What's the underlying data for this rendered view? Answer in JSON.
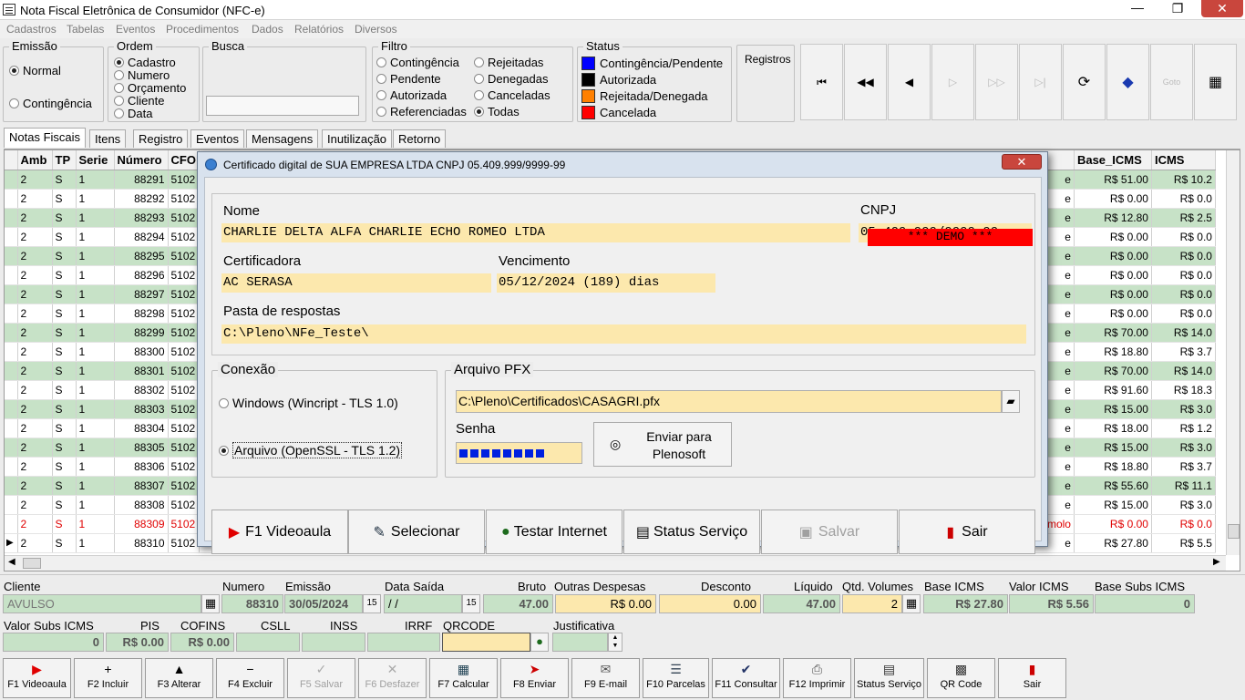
{
  "window": {
    "title": "Nota Fiscal Eletrônica de Consumidor (NFC-e)",
    "minimize": "—",
    "maximize": "❐",
    "close": "✕"
  },
  "menu": [
    "Cadastros",
    "Tabelas",
    "Eventos",
    "Procedimentos",
    "Dados",
    "Relatórios",
    "Diversos"
  ],
  "emissao": {
    "label": "Emissão",
    "options": [
      "Normal",
      "Contingência"
    ]
  },
  "ordem": {
    "label": "Ordem",
    "options": [
      "Cadastro",
      "Numero",
      "Orçamento",
      "Cliente",
      "Data"
    ]
  },
  "busca": {
    "label": "Busca",
    "value": ""
  },
  "filtro": {
    "label": "Filtro",
    "col1": [
      "Contingência",
      "Pendente",
      "Autorizada",
      "Referenciadas"
    ],
    "col2": [
      "Rejeitadas",
      "Denegadas",
      "Canceladas",
      "Todas"
    ]
  },
  "status": {
    "label": "Status",
    "items": [
      {
        "label": "Contingência/Pendente",
        "color": "#0000ff"
      },
      {
        "label": "Autorizada",
        "color": "#000000"
      },
      {
        "label": "Rejeitada/Denegada",
        "color": "#ff8000"
      },
      {
        "label": "Cancelada",
        "color": "#ff0000"
      }
    ]
  },
  "registros": {
    "label": "Registros"
  },
  "nav": {
    "first": "⏮",
    "prev_page": "◀◀",
    "prev": "◀",
    "next": "▷",
    "next_page": "▷▷",
    "last": "▷|",
    "refresh": "⟳",
    "tag": "◆",
    "goto": "Goto",
    "calc": "▦"
  },
  "tabs": [
    "Notas Fiscais",
    "Itens",
    "Registro",
    "Eventos",
    "Mensagens",
    "Inutilização",
    "Retorno"
  ],
  "grid": {
    "columns": [
      "Amb",
      "TP",
      "Serie",
      "Número",
      "CFO"
    ],
    "right_columns": [
      "Base_ICMS",
      "ICMS"
    ],
    "rows": [
      {
        "amb": "2",
        "tp": "S",
        "serie": "1",
        "numero": "88291",
        "cfo": "5102",
        "status": "e",
        "base": "R$ 51.00",
        "icms": "R$ 10.2",
        "style": "green"
      },
      {
        "amb": "2",
        "tp": "S",
        "serie": "1",
        "numero": "88292",
        "cfo": "5102",
        "status": "e",
        "base": "R$ 0.00",
        "icms": "R$ 0.0",
        "style": ""
      },
      {
        "amb": "2",
        "tp": "S",
        "serie": "1",
        "numero": "88293",
        "cfo": "5102",
        "status": "e",
        "base": "R$ 12.80",
        "icms": "R$ 2.5",
        "style": "green"
      },
      {
        "amb": "2",
        "tp": "S",
        "serie": "1",
        "numero": "88294",
        "cfo": "5102",
        "status": "e",
        "base": "R$ 0.00",
        "icms": "R$ 0.0",
        "style": ""
      },
      {
        "amb": "2",
        "tp": "S",
        "serie": "1",
        "numero": "88295",
        "cfo": "5102",
        "status": "e",
        "base": "R$ 0.00",
        "icms": "R$ 0.0",
        "style": "green"
      },
      {
        "amb": "2",
        "tp": "S",
        "serie": "1",
        "numero": "88296",
        "cfo": "5102",
        "status": "e",
        "base": "R$ 0.00",
        "icms": "R$ 0.0",
        "style": ""
      },
      {
        "amb": "2",
        "tp": "S",
        "serie": "1",
        "numero": "88297",
        "cfo": "5102",
        "status": "e",
        "base": "R$ 0.00",
        "icms": "R$ 0.0",
        "style": "green"
      },
      {
        "amb": "2",
        "tp": "S",
        "serie": "1",
        "numero": "88298",
        "cfo": "5102",
        "status": "e",
        "base": "R$ 0.00",
        "icms": "R$ 0.0",
        "style": ""
      },
      {
        "amb": "2",
        "tp": "S",
        "serie": "1",
        "numero": "88299",
        "cfo": "5102",
        "status": "e",
        "base": "R$ 70.00",
        "icms": "R$ 14.0",
        "style": "green"
      },
      {
        "amb": "2",
        "tp": "S",
        "serie": "1",
        "numero": "88300",
        "cfo": "5102",
        "status": "e",
        "base": "R$ 18.80",
        "icms": "R$ 3.7",
        "style": ""
      },
      {
        "amb": "2",
        "tp": "S",
        "serie": "1",
        "numero": "88301",
        "cfo": "5102",
        "status": "e",
        "base": "R$ 70.00",
        "icms": "R$ 14.0",
        "style": "green"
      },
      {
        "amb": "2",
        "tp": "S",
        "serie": "1",
        "numero": "88302",
        "cfo": "5102",
        "status": "e",
        "base": "R$ 91.60",
        "icms": "R$ 18.3",
        "style": ""
      },
      {
        "amb": "2",
        "tp": "S",
        "serie": "1",
        "numero": "88303",
        "cfo": "5102",
        "status": "e",
        "base": "R$ 15.00",
        "icms": "R$ 3.0",
        "style": "green"
      },
      {
        "amb": "2",
        "tp": "S",
        "serie": "1",
        "numero": "88304",
        "cfo": "5102",
        "status": "e",
        "base": "R$ 18.00",
        "icms": "R$ 1.2",
        "style": ""
      },
      {
        "amb": "2",
        "tp": "S",
        "serie": "1",
        "numero": "88305",
        "cfo": "5102",
        "status": "e",
        "base": "R$ 15.00",
        "icms": "R$ 3.0",
        "style": "green"
      },
      {
        "amb": "2",
        "tp": "S",
        "serie": "1",
        "numero": "88306",
        "cfo": "5102",
        "status": "e",
        "base": "R$ 18.80",
        "icms": "R$ 3.7",
        "style": ""
      },
      {
        "amb": "2",
        "tp": "S",
        "serie": "1",
        "numero": "88307",
        "cfo": "5102",
        "status": "e",
        "base": "R$ 55.60",
        "icms": "R$ 11.1",
        "style": "green"
      },
      {
        "amb": "2",
        "tp": "S",
        "serie": "1",
        "numero": "88308",
        "cfo": "5102",
        "status": "e",
        "base": "R$ 15.00",
        "icms": "R$ 3.0",
        "style": ""
      },
      {
        "amb": "2",
        "tp": "S",
        "serie": "1",
        "numero": "88309",
        "cfo": "5102",
        "status": "nomolo",
        "base": "R$ 0.00",
        "icms": "R$ 0.0",
        "style": "red"
      },
      {
        "amb": "2",
        "tp": "S",
        "serie": "1",
        "numero": "88310",
        "cfo": "5102",
        "status": "e",
        "base": "R$ 27.80",
        "icms": "R$ 5.5",
        "style": ""
      }
    ]
  },
  "dialog": {
    "title": "Certificado digital de SUA EMPRESA LTDA CNPJ 05.409.999/9999-99",
    "close": "✕",
    "nome_label": "Nome",
    "nome": "CHARLIE DELTA ALFA CHARLIE ECHO ROMEO LTDA",
    "cnpj_label": "CNPJ",
    "cnpj": "05.409.999/9999-99",
    "demo": "*** DEMO ***",
    "certificadora_label": "Certificadora",
    "certificadora": "AC SERASA",
    "vencimento_label": "Vencimento",
    "vencimento": "05/12/2024 (189) dias",
    "pasta_label": "Pasta de respostas",
    "pasta": "C:\\Pleno\\NFe_Teste\\",
    "conexao_label": "Conexão",
    "conexao_opt1": "Windows (Wincript - TLS 1.0)",
    "conexao_opt2": "Arquivo  (OpenSSL - TLS 1.2)",
    "pfx_label": "Arquivo PFX",
    "pfx": "C:\\Pleno\\Certificados\\CASAGRI.pfx",
    "senha_label": "Senha",
    "enviar": "Enviar para\nPlenosoft",
    "buttons": {
      "videoaula": "F1 Videoaula",
      "selecionar": "Selecionar",
      "testar": "Testar Internet",
      "status": "Status Serviço",
      "salvar": "Salvar",
      "sair": "Sair"
    }
  },
  "bottom": {
    "cliente_label": "Cliente",
    "cliente": "AVULSO",
    "numero_label": "Numero",
    "numero": "88310",
    "emissao_label": "Emissão",
    "emissao": "30/05/2024",
    "saida_label": "Data Saída",
    "saida": " / /",
    "bruto_label": "Bruto",
    "bruto": "47.00",
    "outras_label": "Outras Despesas",
    "outras": "R$ 0.00",
    "desconto_label": "Desconto",
    "desconto": "0.00",
    "liquido_label": "Líquido",
    "liquido": "47.00",
    "volumes_label": "Qtd. Volumes",
    "volumes": "2",
    "baseicms_label": "Base ICMS",
    "baseicms": "R$ 27.80",
    "valoricms_label": "Valor ICMS",
    "valoricms": "R$ 5.56",
    "basesubs_label": "Base Subs ICMS",
    "basesubs": "0",
    "valorsubs_label": "Valor Subs ICMS",
    "valorsubs": "0",
    "pis_label": "PIS",
    "pis": "R$ 0.00",
    "cofins_label": "COFINS",
    "cofins": "R$ 0.00",
    "csll_label": "CSLL",
    "inss_label": "INSS",
    "irrf_label": "IRRF",
    "qrcode_label": "QRCODE",
    "justificativa_label": "Justificativa"
  },
  "footer": [
    {
      "label": "F1 Videoaula",
      "icon": "▶",
      "color": "#e00000"
    },
    {
      "label": "F2 Incluir",
      "icon": "+",
      "color": "#000"
    },
    {
      "label": "F3 Alterar",
      "icon": "▲",
      "color": "#000"
    },
    {
      "label": "F4 Excluir",
      "icon": "−",
      "color": "#000"
    },
    {
      "label": "F5 Salvar",
      "icon": "✓",
      "color": "#aaa"
    },
    {
      "label": "F6 Desfazer",
      "icon": "✕",
      "color": "#aaa"
    },
    {
      "label": "F7 Calcular",
      "icon": "▦",
      "color": "#245"
    },
    {
      "label": "F8 Enviar",
      "icon": "➤",
      "color": "#c00"
    },
    {
      "label": "F9 E-mail",
      "icon": "✉",
      "color": "#555"
    },
    {
      "label": "F10 Parcelas",
      "icon": "☰",
      "color": "#345"
    },
    {
      "label": "F11 Consultar",
      "icon": "✔",
      "color": "#236"
    },
    {
      "label": "F12 Imprimir",
      "icon": "⎙",
      "color": "#555"
    },
    {
      "label": "Status Serviço",
      "icon": "▤",
      "color": "#333"
    },
    {
      "label": "QR Code",
      "icon": "▩",
      "color": "#333"
    },
    {
      "label": "Sair",
      "icon": "▮",
      "color": "#c00"
    }
  ]
}
